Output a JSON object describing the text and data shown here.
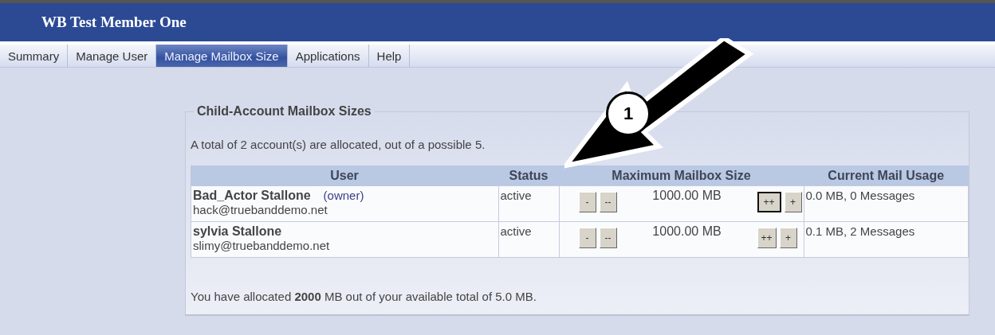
{
  "header": {
    "title": "WB Test Member One"
  },
  "tabs": [
    {
      "label": "Summary",
      "selected": false
    },
    {
      "label": "Manage User",
      "selected": false
    },
    {
      "label": "Manage Mailbox Size",
      "selected": true
    },
    {
      "label": "Applications",
      "selected": false
    },
    {
      "label": "Help",
      "selected": false
    }
  ],
  "panel": {
    "title": "Child-Account Mailbox Sizes",
    "summary": "A total of 2 account(s) are allocated, out of a possible 5.",
    "footer": "You have allocated **2000** MB out of your available total of 5.0 MB."
  },
  "table": {
    "columns": [
      "User",
      "Status",
      "Maximum Mailbox Size",
      "Current Mail Usage"
    ],
    "rows": [
      {
        "name": "Bad_Actor Stallone",
        "role": "(owner)",
        "email": "hack@truebanddemo.net",
        "status": "active",
        "buttons": [
          {
            "label": "-",
            "focused": false
          },
          {
            "label": "--",
            "focused": false
          },
          {
            "label": "++",
            "focused": true
          },
          {
            "label": "+",
            "focused": false
          }
        ],
        "size": "1000.00 MB",
        "usage": "0.0 MB, 0 Messages"
      },
      {
        "name": "sylvia Stallone",
        "email": "slimy@truebanddemo.net",
        "status": "active",
        "buttons": [
          {
            "label": "-",
            "focused": false
          },
          {
            "label": "--",
            "focused": false
          },
          {
            "label": "++",
            "focused": false
          },
          {
            "label": "+",
            "focused": false
          }
        ],
        "size": "1000.00 MB",
        "usage": "0.1 MB, 2 Messages"
      }
    ]
  },
  "callout": {
    "label": "1"
  }
}
